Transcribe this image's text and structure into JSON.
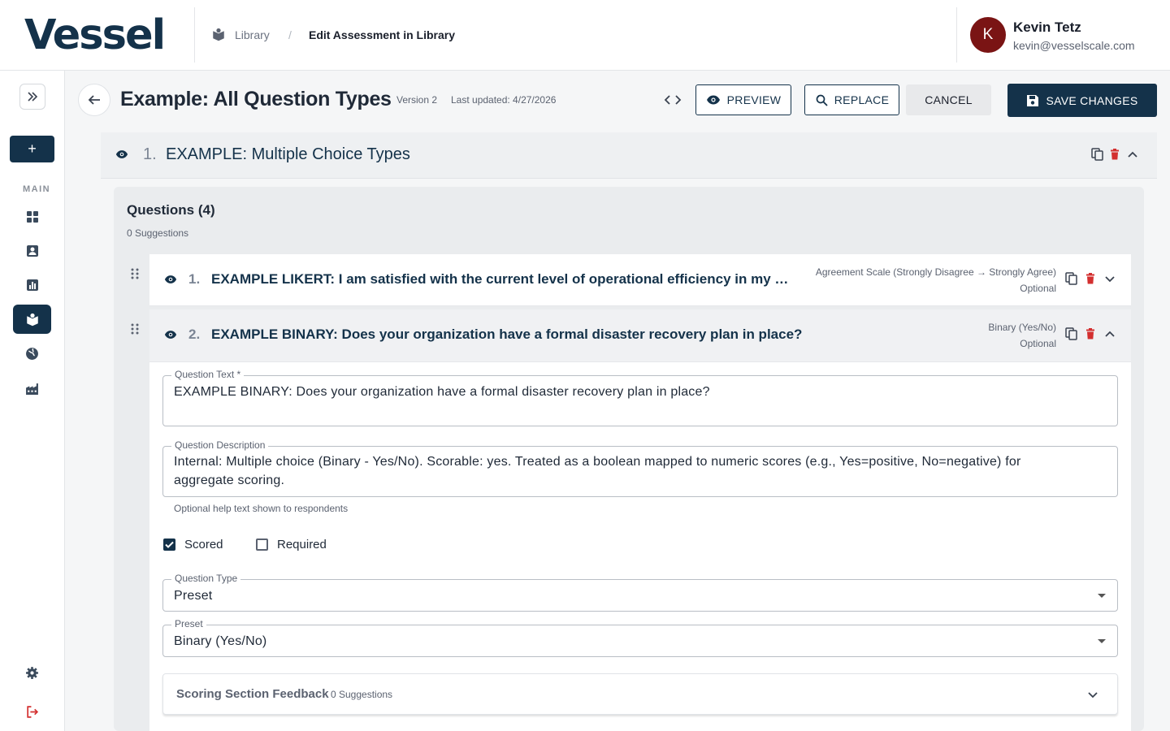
{
  "header": {
    "logo": "Vessel",
    "breadcrumb": {
      "library": "Library",
      "separator": "/",
      "current": "Edit Assessment in Library"
    },
    "user": {
      "initial": "K",
      "name": "Kevin Tetz",
      "email": "kevin@vesselscale.com"
    }
  },
  "sidebar": {
    "add_label": "+",
    "section_label": "MAIN",
    "items": [
      {
        "name": "dashboard-icon"
      },
      {
        "name": "contacts-icon"
      },
      {
        "name": "reports-icon"
      },
      {
        "name": "library-icon",
        "active": true
      },
      {
        "name": "globe-icon"
      },
      {
        "name": "factory-icon"
      }
    ],
    "bottom": [
      {
        "name": "settings-icon"
      },
      {
        "name": "logout-icon"
      }
    ]
  },
  "toolbar": {
    "title": "Example: All Question Types",
    "version": "Version 2",
    "updated": "Last updated: 4/27/2026",
    "preview_label": "PREVIEW",
    "replace_label": "REPLACE",
    "cancel_label": "CANCEL",
    "save_label": "SAVE CHANGES"
  },
  "section": {
    "number": "1.",
    "title": "EXAMPLE: Multiple Choice Types",
    "questions_heading": "Questions (4)",
    "suggestions": "0 Suggestions"
  },
  "questions": [
    {
      "number": "1.",
      "text": "EXAMPLE LIKERT: I am satisfied with the current level of operational efficiency in my organization.",
      "scale": "Agreement Scale (Strongly Disagree → Strongly Agree)",
      "required_state": "Optional"
    },
    {
      "number": "2.",
      "text": "EXAMPLE BINARY: Does your organization have a formal disaster recovery plan in place?",
      "scale": "Binary (Yes/No)",
      "required_state": "Optional"
    }
  ],
  "editor": {
    "question_text_label": "Question Text *",
    "question_text_value": "EXAMPLE BINARY: Does your organization have a formal disaster recovery plan in place?",
    "description_label": "Question Description",
    "description_value": "Internal: Multiple choice (Binary - Yes/No). Scorable: yes. Treated as a boolean mapped to numeric scores (e.g., Yes=positive, No=negative) for aggregate scoring.",
    "helper_text": "Optional help text shown to respondents",
    "scored_label": "Scored",
    "scored_checked": true,
    "required_label": "Required",
    "required_checked": false,
    "type_label": "Question Type",
    "type_value": "Preset",
    "preset_label": "Preset",
    "preset_value": "Binary (Yes/No)",
    "feedback_title": "Scoring Section Feedback",
    "feedback_suggestions": "0 Suggestions"
  },
  "colors": {
    "brand": "#14324a",
    "danger": "#d32f2f",
    "avatar": "#7a1414",
    "logout": "#d32f2f"
  }
}
